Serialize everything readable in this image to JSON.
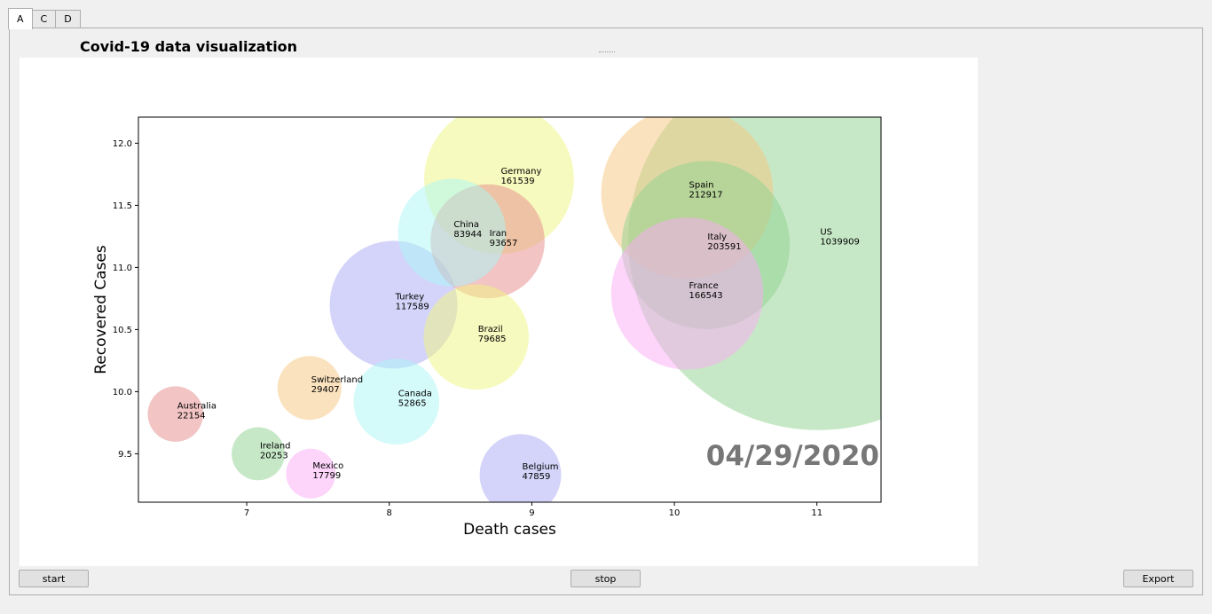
{
  "tabs": [
    {
      "label": "A",
      "active": true
    },
    {
      "label": "C",
      "active": false
    },
    {
      "label": "D",
      "active": false
    }
  ],
  "panel": {
    "title": "Covid-19 data visualization"
  },
  "buttons": {
    "start": "start",
    "stop": "stop",
    "export": "Export"
  },
  "chart_data": {
    "type": "scatter",
    "title": "",
    "xlabel": "Death cases",
    "ylabel": "Recovered Cases",
    "xlim": [
      6.24,
      11.45
    ],
    "ylim": [
      9.11,
      12.21
    ],
    "xticks": [
      7,
      8,
      9,
      10,
      11
    ],
    "yticks": [
      9.5,
      10.0,
      10.5,
      11.0,
      11.5,
      12.0
    ],
    "grid": false,
    "date_label": "04/29/2020",
    "points": [
      {
        "name": "US",
        "x": 11.01,
        "y": 11.22,
        "value": 1039909,
        "color": "#8fd18f"
      },
      {
        "name": "Spain",
        "x": 10.09,
        "y": 11.6,
        "value": 212917,
        "color": "#f7c57e"
      },
      {
        "name": "Italy",
        "x": 10.22,
        "y": 11.18,
        "value": 203591,
        "color": "#8fd18f"
      },
      {
        "name": "France",
        "x": 10.09,
        "y": 10.79,
        "value": 166543,
        "color": "#fbaaf5"
      },
      {
        "name": "Germany",
        "x": 8.77,
        "y": 11.71,
        "value": 161539,
        "color": "#eff57e"
      },
      {
        "name": "Turkey",
        "x": 8.03,
        "y": 10.7,
        "value": 117589,
        "color": "#aaaaf5"
      },
      {
        "name": "Iran",
        "x": 8.69,
        "y": 11.21,
        "value": 93657,
        "color": "#e58a8a"
      },
      {
        "name": "China",
        "x": 8.44,
        "y": 11.28,
        "value": 83944,
        "color": "#a9f5f5"
      },
      {
        "name": "Brazil",
        "x": 8.61,
        "y": 10.44,
        "value": 79685,
        "color": "#eff57e"
      },
      {
        "name": "Canada",
        "x": 8.05,
        "y": 9.92,
        "value": 52865,
        "color": "#a9f5f5"
      },
      {
        "name": "Belgium",
        "x": 8.92,
        "y": 9.33,
        "value": 47859,
        "color": "#aaaaf5"
      },
      {
        "name": "Switzerland",
        "x": 7.44,
        "y": 10.03,
        "value": 29407,
        "color": "#f7c57e"
      },
      {
        "name": "Australia",
        "x": 6.5,
        "y": 9.82,
        "value": 22154,
        "color": "#e58a8a"
      },
      {
        "name": "Ireland",
        "x": 7.08,
        "y": 9.5,
        "value": 20253,
        "color": "#8fd18f"
      },
      {
        "name": "Mexico",
        "x": 7.45,
        "y": 9.34,
        "value": 17799,
        "color": "#fbaaf5"
      }
    ]
  }
}
